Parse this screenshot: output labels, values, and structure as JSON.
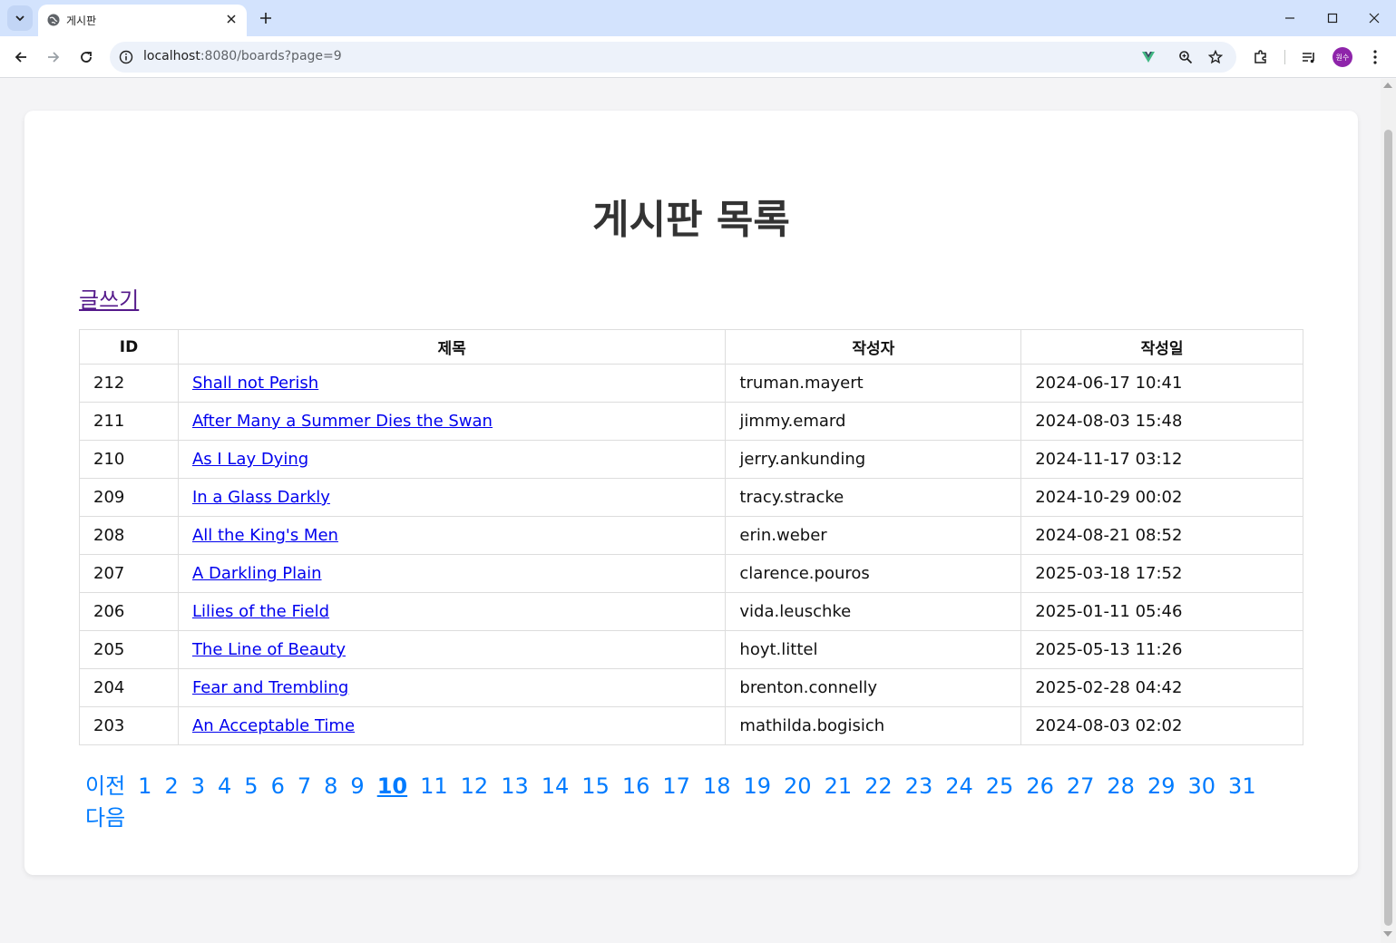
{
  "browser": {
    "tab_title": "게시판",
    "url_host": "localhost",
    "url_path": ":8080/boards?page=9",
    "profile_label": "원수"
  },
  "page": {
    "title": "게시판 목록",
    "write_link": "글쓰기"
  },
  "table": {
    "headers": [
      "ID",
      "제목",
      "작성자",
      "작성일"
    ],
    "rows": [
      {
        "id": "212",
        "title": "Shall not Perish",
        "writer": "truman.mayert",
        "date": "2024-06-17 10:41"
      },
      {
        "id": "211",
        "title": "After Many a Summer Dies the Swan",
        "writer": "jimmy.emard",
        "date": "2024-08-03 15:48"
      },
      {
        "id": "210",
        "title": "As I Lay Dying",
        "writer": "jerry.ankunding",
        "date": "2024-11-17 03:12"
      },
      {
        "id": "209",
        "title": "In a Glass Darkly",
        "writer": "tracy.stracke",
        "date": "2024-10-29 00:02"
      },
      {
        "id": "208",
        "title": "All the King's Men",
        "writer": "erin.weber",
        "date": "2024-08-21 08:52"
      },
      {
        "id": "207",
        "title": "A Darkling Plain",
        "writer": "clarence.pouros",
        "date": "2025-03-18 17:52"
      },
      {
        "id": "206",
        "title": "Lilies of the Field",
        "writer": "vida.leuschke",
        "date": "2025-01-11 05:46"
      },
      {
        "id": "205",
        "title": "The Line of Beauty",
        "writer": "hoyt.littel",
        "date": "2025-05-13 11:26"
      },
      {
        "id": "204",
        "title": "Fear and Trembling",
        "writer": "brenton.connelly",
        "date": "2025-02-28 04:42"
      },
      {
        "id": "203",
        "title": "An Acceptable Time",
        "writer": "mathilda.bogisich",
        "date": "2024-08-03 02:02"
      }
    ]
  },
  "pagination": {
    "prev": "이전",
    "next": "다음",
    "pages": [
      "1",
      "2",
      "3",
      "4",
      "5",
      "6",
      "7",
      "8",
      "9",
      "10",
      "11",
      "12",
      "13",
      "14",
      "15",
      "16",
      "17",
      "18",
      "19",
      "20",
      "21",
      "22",
      "23",
      "24",
      "25",
      "26",
      "27",
      "28",
      "29",
      "30",
      "31"
    ],
    "current": "10"
  },
  "colors": {
    "link": "#0000ee",
    "visited": "#551a8b",
    "pagination": "#007bff",
    "profile": "#8e24aa"
  }
}
